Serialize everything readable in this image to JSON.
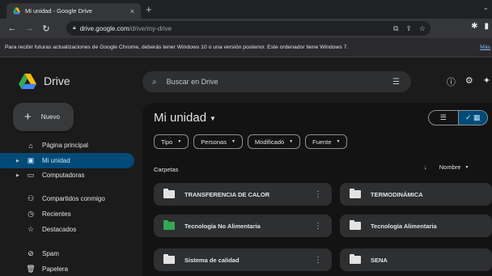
{
  "browser": {
    "tab_title": "Mi unidad - Google Drive",
    "tab_close": "×",
    "new_tab": "+",
    "url_host": "drive.google.com",
    "url_path": "/drive/my-drive"
  },
  "infobar": {
    "message": "Para recibir futuras actualizaciones de Google Chrome, deberás tener Windows 10 o una versión posterior. Este ordenador tiene Windows 7.",
    "more": "Más"
  },
  "header": {
    "logo_text": "Drive",
    "search_placeholder": "Buscar en Drive"
  },
  "sidebar": {
    "new_button": "Nuevo",
    "items": [
      {
        "label": "Página principal",
        "icon": "home-icon"
      },
      {
        "label": "Mi unidad",
        "icon": "my-drive-icon"
      },
      {
        "label": "Computadoras",
        "icon": "computer-icon"
      },
      {
        "label": "Compartidos conmigo",
        "icon": "shared-icon"
      },
      {
        "label": "Recientes",
        "icon": "clock-icon"
      },
      {
        "label": "Destacados",
        "icon": "star-icon"
      },
      {
        "label": "Spam",
        "icon": "spam-icon"
      },
      {
        "label": "Papelera",
        "icon": "trash-icon"
      }
    ]
  },
  "main": {
    "title": "Mi unidad",
    "chips": [
      "Tipo",
      "Personas",
      "Modificado",
      "Fuente"
    ],
    "section_label": "Carpetas",
    "sort_label": "Nombre",
    "folders": [
      {
        "name": "TRANSFERENCIA DE CALOR",
        "color": "#e3e3e3",
        "shared": true
      },
      {
        "name": "TERMODINÁMICA",
        "color": "#e3e3e3"
      },
      {
        "name": "Tecnología No Alimentaria",
        "color": "#34a853"
      },
      {
        "name": "Tecnología Alimentaria",
        "color": "#e3e3e3"
      },
      {
        "name": "Sistema de calidad",
        "color": "#e3e3e3"
      },
      {
        "name": "SENA",
        "color": "#e3e3e3"
      }
    ]
  },
  "colors": {
    "accent": "#004a77",
    "accent_text": "#c2e7ff",
    "link": "#8ab4f8"
  }
}
